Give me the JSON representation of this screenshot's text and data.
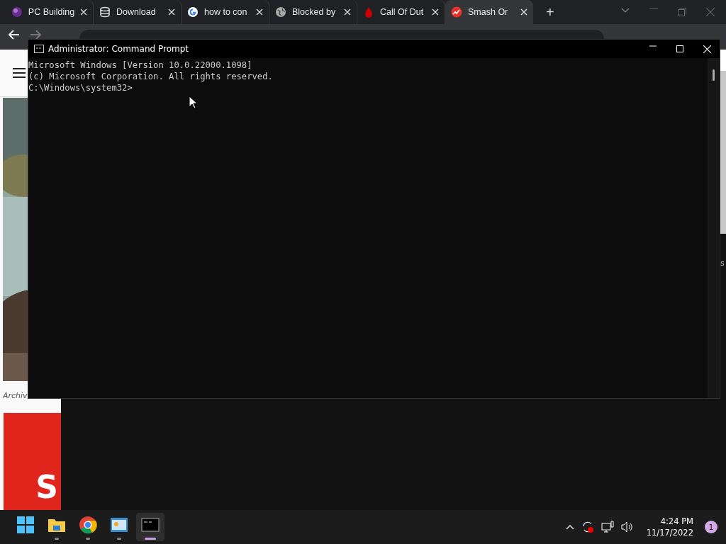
{
  "browser": {
    "tabs": [
      {
        "title": "PC Building",
        "selected": false
      },
      {
        "title": "Download",
        "selected": false
      },
      {
        "title": "how to con",
        "selected": false
      },
      {
        "title": "Blocked by",
        "selected": false
      },
      {
        "title": "Call Of Dut",
        "selected": false
      },
      {
        "title": "Smash Or",
        "selected": true
      }
    ],
    "new_tab": "+",
    "page": {
      "caption": "Archiv",
      "card_letter": "S",
      "edge_letter": "s"
    }
  },
  "console": {
    "title": "Administrator: Command Prompt",
    "lines": [
      "Microsoft Windows [Version 10.0.22000.1098]",
      "(c) Microsoft Corporation. All rights reserved.",
      "C:\\Windows\\system32>"
    ]
  },
  "taskbar": {
    "apps": [
      {
        "kind": "start",
        "running": false,
        "selected": false
      },
      {
        "kind": "folder",
        "running": true,
        "selected": false
      },
      {
        "kind": "chrome",
        "running": true,
        "selected": false
      },
      {
        "kind": "panel",
        "running": true,
        "selected": false
      },
      {
        "kind": "terminal",
        "running": true,
        "selected": true
      }
    ],
    "time": "4:24 PM",
    "date": "11/17/2022",
    "notifications": "1"
  }
}
